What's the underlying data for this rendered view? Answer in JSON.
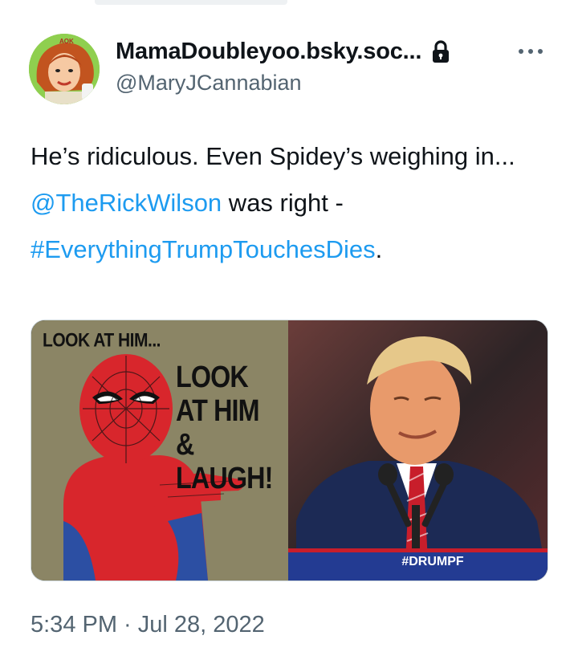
{
  "tweet": {
    "display_name": "MamaDoubleyoo.bsky.soc...",
    "handle": "@MaryJCannabian",
    "text_parts": {
      "p1": "He’s ridiculous. Even Spidey’s weighing in... ",
      "mention": "@TheRickWilson",
      "p2": " was right - ",
      "hashtag": "#EverythingTrumpTouchesDies",
      "p3": "."
    },
    "timestamp": "5:34 PM · Jul 28, 2022",
    "avatar_badge": "AOK"
  },
  "media": {
    "caption_top": "LOOK AT HIM...",
    "caption_main": "LOOK AT HIM & LAUGH!",
    "banner": "#DRUMPF"
  },
  "icons": {
    "lock": "lock-icon",
    "more": "more-icon"
  },
  "colors": {
    "link": "#1d9bf0",
    "secondary_text": "#536471",
    "primary_text": "#0f1419"
  }
}
